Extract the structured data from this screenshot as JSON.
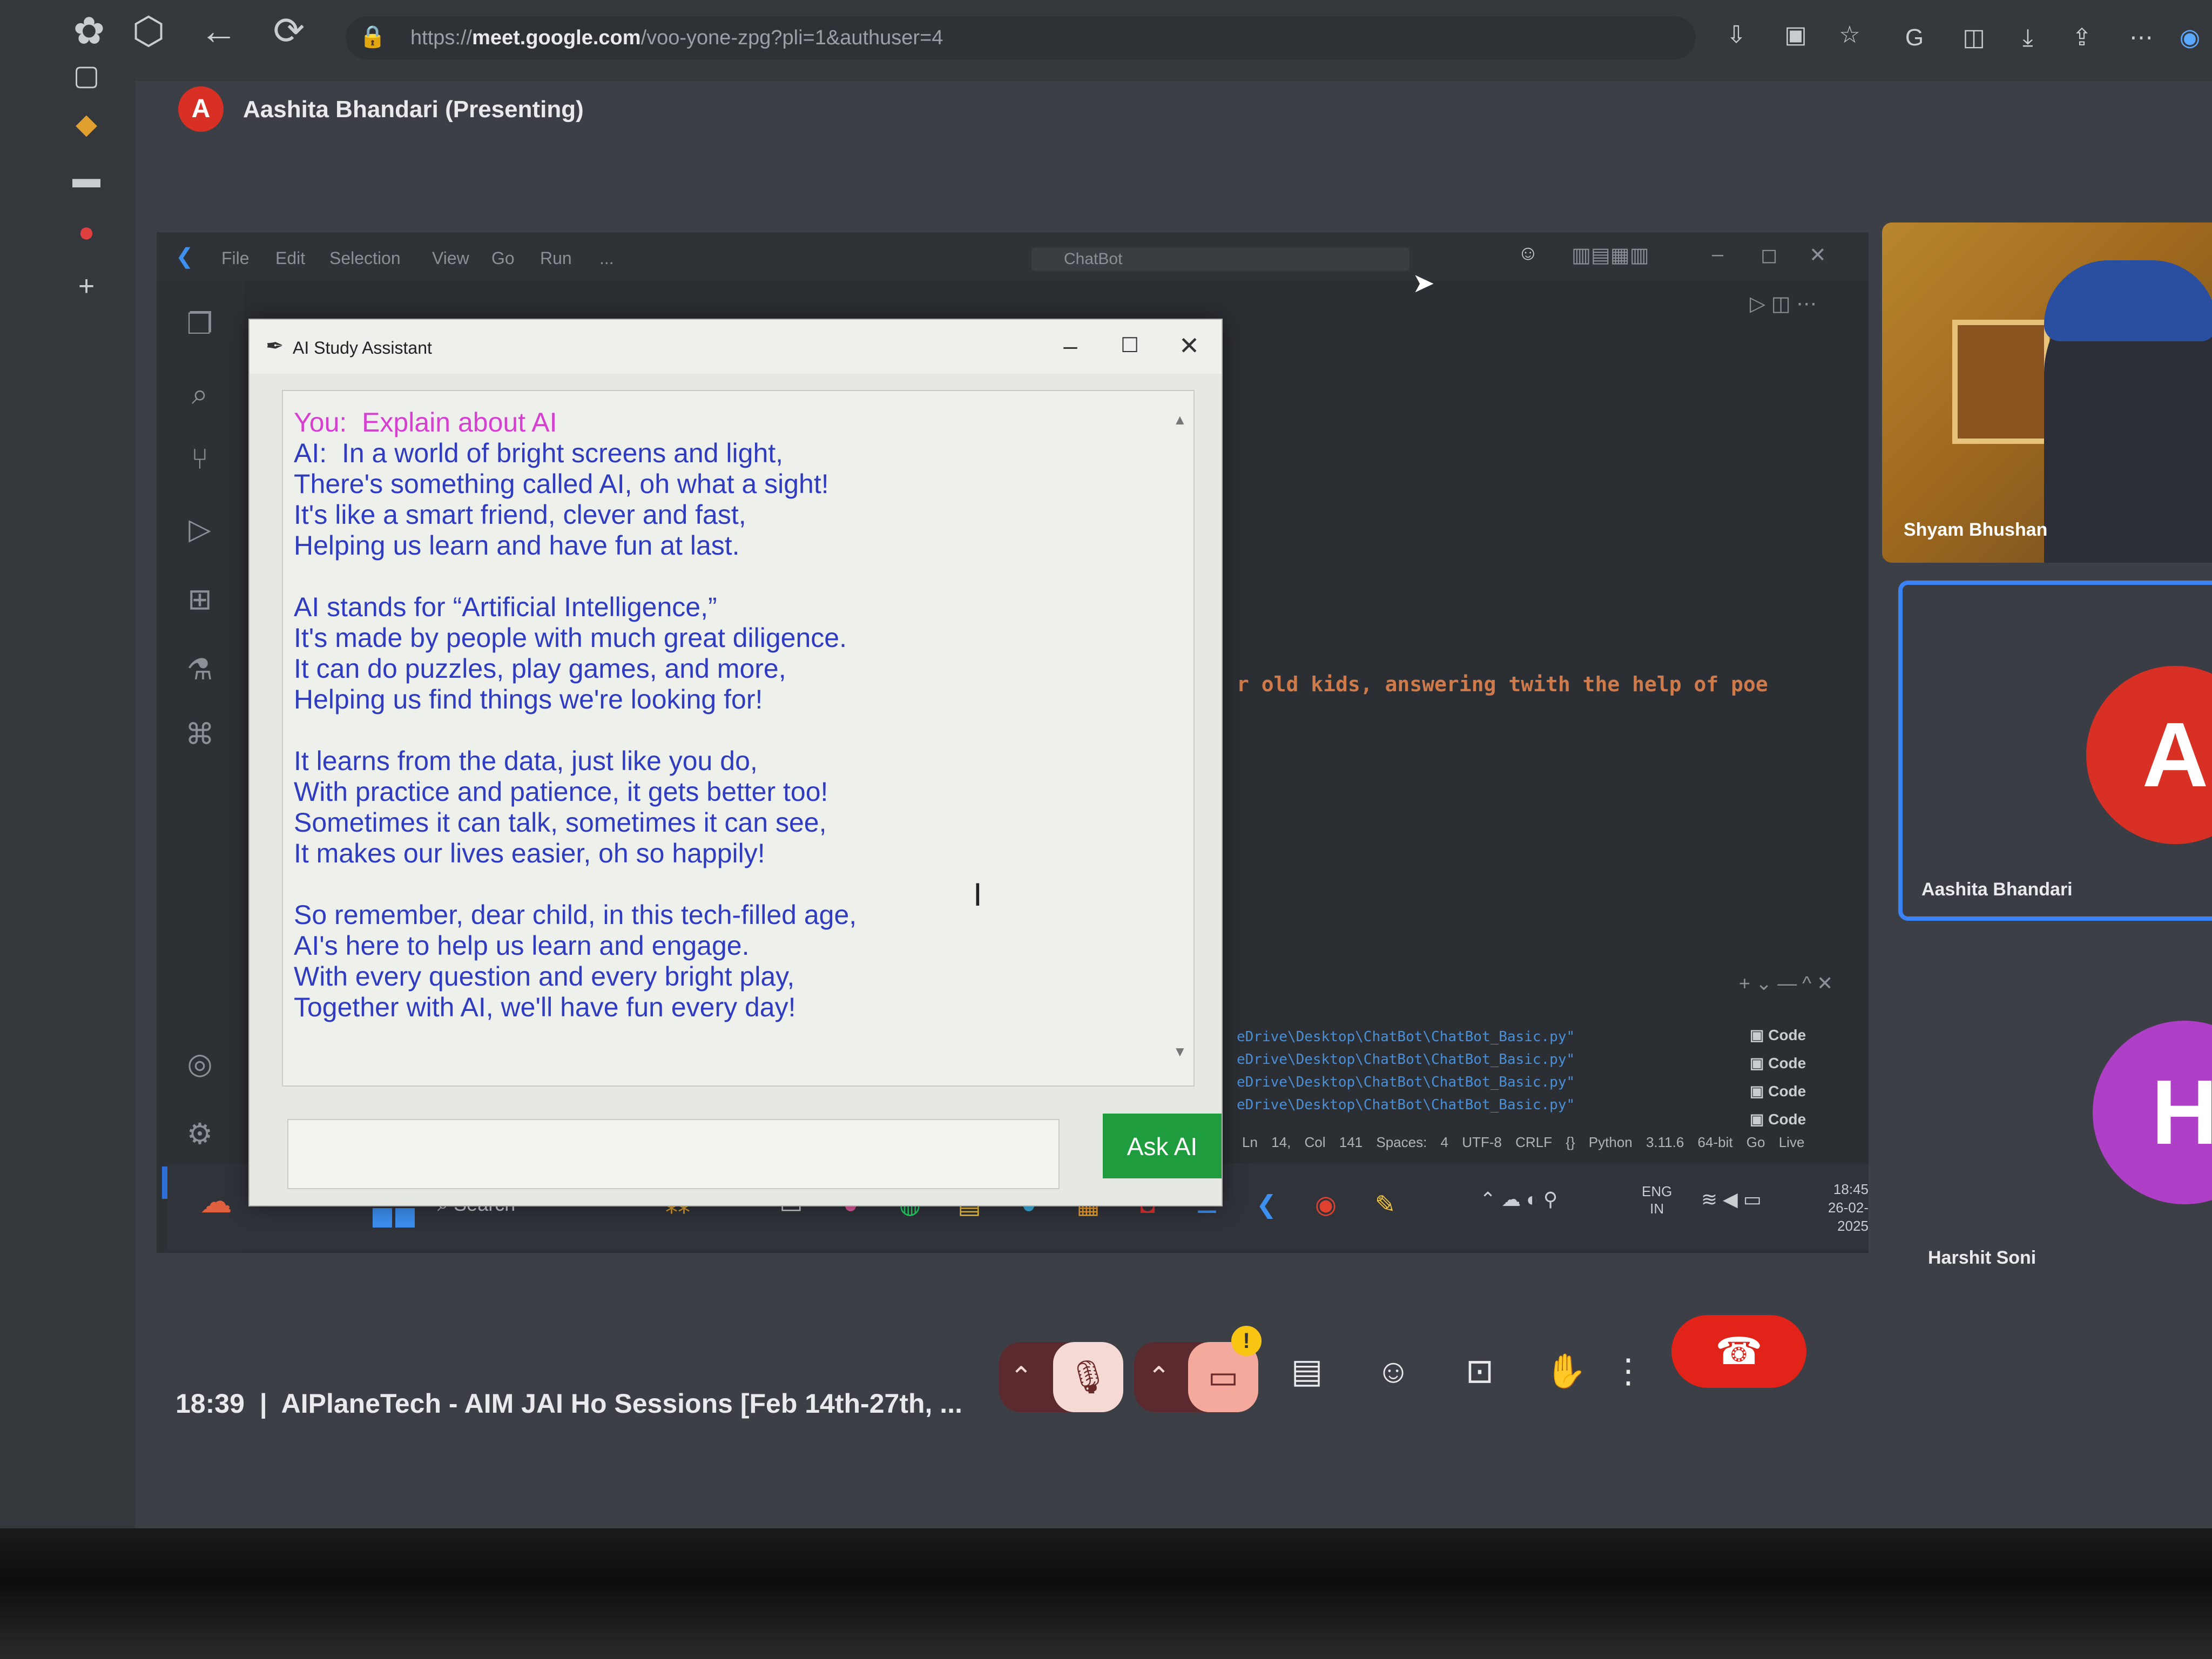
{
  "browser": {
    "url_prefix": "https://",
    "url_host": "meet.google.com",
    "url_path": "/voo-yone-zpg?pli=1&authuser=4"
  },
  "meet": {
    "presenter_initial": "A",
    "presenter_label": "Aashita Bhandari (Presenting)",
    "time": "18:39",
    "separator": "|",
    "meeting_title": "AIPlaneTech - AIM JAI Ho Sessions [Feb 14th-27th, ...",
    "participants": [
      {
        "name": "Shyam Bhushan"
      },
      {
        "name": "Aashita Bhandari",
        "initial": "A"
      },
      {
        "name": "Harshit Soni",
        "initial": "H"
      }
    ]
  },
  "vscode": {
    "menu": [
      "File",
      "Edit",
      "Selection",
      "View",
      "Go",
      "Run",
      "..."
    ],
    "search_placeholder": "ChatBot",
    "code_comment": "r old kids, answering twith the help of poe",
    "terminal_lines": [
      "eDrive\\Desktop\\ChatBot\\ChatBot_Basic.py\"",
      "eDrive\\Desktop\\ChatBot\\ChatBot_Basic.py\"",
      "eDrive\\Desktop\\ChatBot\\ChatBot_Basic.py\"",
      "eDrive\\Desktop\\ChatBot\\ChatBot_Basic.py\""
    ],
    "terminal_tabs": [
      "Code",
      "Code",
      "Code",
      "Code"
    ],
    "status_bar": "Ln 14, Col 141   Spaces: 4   UTF-8   CRLF   {} Python   3.11.6 64-bit   Go Live"
  },
  "taskbar": {
    "search_label": "Search",
    "lang_line1": "ENG",
    "lang_line2": "IN",
    "clock_time": "18:45",
    "clock_date": "26-02-2025"
  },
  "ai_app": {
    "window_title": "AI Study Assistant",
    "user_prefix": "You:",
    "user_message": "Explain about AI",
    "ai_prefix": "AI:",
    "poem_lines": [
      "In a world of bright screens and light,",
      "There's something called AI, oh what a sight!",
      "It's like a smart friend, clever and fast,",
      "Helping us learn and have fun at last.",
      "",
      "AI stands for “Artificial Intelligence,”",
      "It's made by people with much great diligence.",
      "It can do puzzles, play games, and more,",
      "Helping us find things we're looking for!",
      "",
      "It learns from the data, just like you do,",
      "With practice and patience, it gets better too!",
      "Sometimes it can talk, sometimes it can see,",
      "It makes our lives easier, oh so happily!",
      "",
      "So remember, dear child, in this tech-filled age,",
      "AI's here to help us learn and engage.",
      "With every question and every bright play,",
      "Together with AI, we'll have fun every day!"
    ],
    "input_value": "",
    "ask_button": "Ask AI"
  },
  "colors": {
    "ask_button": "#1f9c3e",
    "user_text": "#d63fd0",
    "ai_text": "#2f3cc0",
    "hangup": "#e2231a",
    "avatar_a": "#d93025",
    "avatar_h": "#b03fc7",
    "active_speaker_border": "#3b82f6"
  }
}
